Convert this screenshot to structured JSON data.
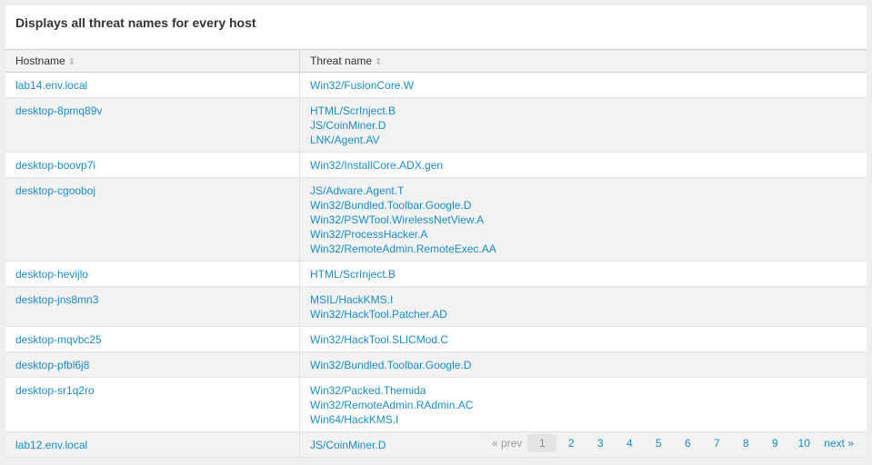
{
  "panel": {
    "title": "Displays all threat names for every host"
  },
  "table": {
    "columns": [
      "Hostname",
      "Threat name"
    ],
    "rows": [
      {
        "host": "lab14.env.local",
        "threats": [
          "Win32/FusionCore.W"
        ]
      },
      {
        "host": "desktop-8pmq89v",
        "threats": [
          "HTML/ScrInject.B",
          "JS/CoinMiner.D",
          "LNK/Agent.AV"
        ]
      },
      {
        "host": "desktop-boovp7i",
        "threats": [
          "Win32/InstallCore.ADX.gen"
        ]
      },
      {
        "host": "desktop-cgooboj",
        "threats": [
          "JS/Adware.Agent.T",
          "Win32/Bundled.Toolbar.Google.D",
          "Win32/PSWTool.WirelessNetView.A",
          "Win32/ProcessHacker.A",
          "Win32/RemoteAdmin.RemoteExec.AA"
        ]
      },
      {
        "host": "desktop-hevijlo",
        "threats": [
          "HTML/ScrInject.B"
        ]
      },
      {
        "host": "desktop-jns8mn3",
        "threats": [
          "MSIL/HackKMS.I",
          "Win32/HackTool.Patcher.AD"
        ]
      },
      {
        "host": "desktop-mqvbc25",
        "threats": [
          "Win32/HackTool.SLICMod.C"
        ]
      },
      {
        "host": "desktop-pfbl6j8",
        "threats": [
          "Win32/Bundled.Toolbar.Google.D"
        ]
      },
      {
        "host": "desktop-sr1q2ro",
        "threats": [
          "Win32/Packed.Themida",
          "Win32/RemoteAdmin.RAdmin.AC",
          "Win64/HackKMS.I"
        ]
      },
      {
        "host": "lab12.env.local",
        "threats": [
          "JS/CoinMiner.D"
        ]
      }
    ]
  },
  "pagination": {
    "prev_label": "« prev",
    "pages": [
      "1",
      "2",
      "3",
      "4",
      "5",
      "6",
      "7",
      "8",
      "9",
      "10"
    ],
    "current": "1",
    "next_label": "next »"
  }
}
